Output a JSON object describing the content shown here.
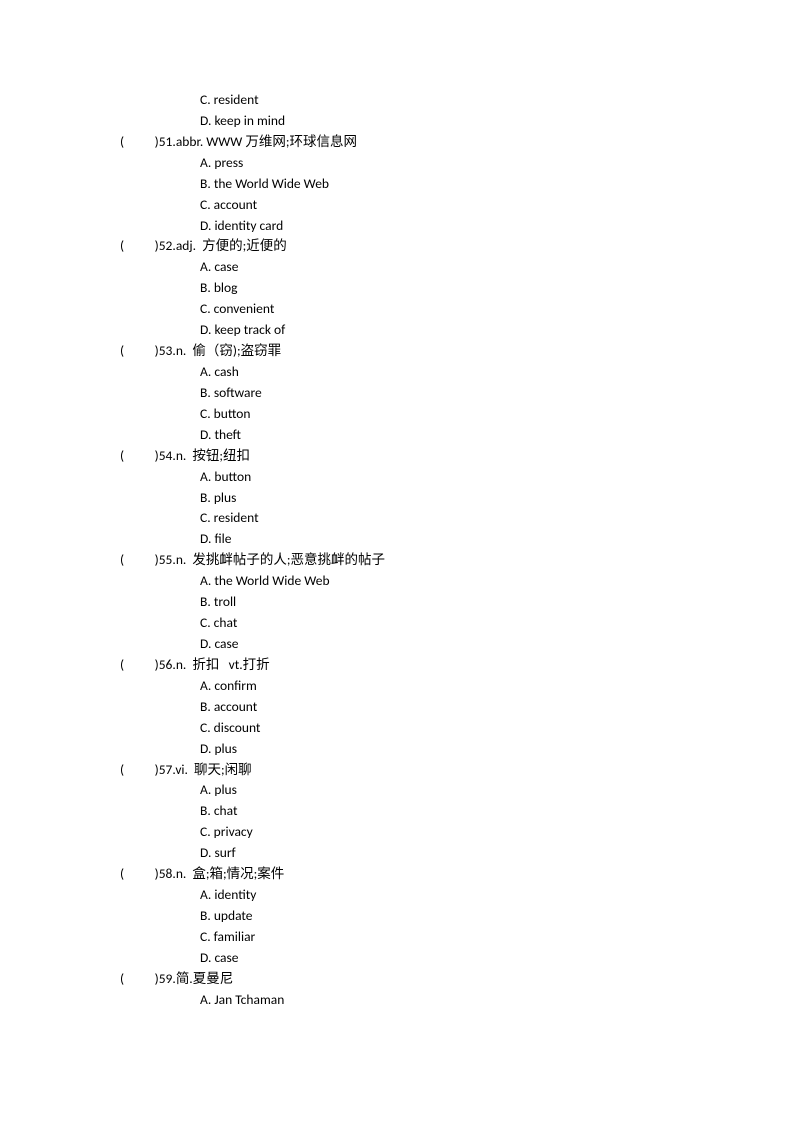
{
  "leading_options": [
    {
      "letter": "C",
      "text": "resident"
    },
    {
      "letter": "D",
      "text": "keep in mind"
    }
  ],
  "questions": [
    {
      "num": "51",
      "prompt": "abbr. WWW 万维网;环球信息网",
      "options": [
        {
          "letter": "A",
          "text": "press"
        },
        {
          "letter": "B",
          "text": "the World Wide Web"
        },
        {
          "letter": "C",
          "text": "account"
        },
        {
          "letter": "D",
          "text": "identity card"
        }
      ]
    },
    {
      "num": "52",
      "prompt": "adj.  方便的;近便的",
      "options": [
        {
          "letter": "A",
          "text": "case"
        },
        {
          "letter": "B",
          "text": "blog"
        },
        {
          "letter": "C",
          "text": "convenient"
        },
        {
          "letter": "D",
          "text": "keep track of"
        }
      ]
    },
    {
      "num": "53",
      "prompt": "n.  偷（窃);盗窃罪",
      "options": [
        {
          "letter": "A",
          "text": "cash"
        },
        {
          "letter": "B",
          "text": "software"
        },
        {
          "letter": "C",
          "text": "button"
        },
        {
          "letter": "D",
          "text": "theft"
        }
      ]
    },
    {
      "num": "54",
      "prompt": "n.  按钮;纽扣",
      "options": [
        {
          "letter": "A",
          "text": "button"
        },
        {
          "letter": "B",
          "text": "plus"
        },
        {
          "letter": "C",
          "text": "resident"
        },
        {
          "letter": "D",
          "text": "file"
        }
      ]
    },
    {
      "num": "55",
      "prompt": "n.  发挑衅帖子的人;恶意挑衅的帖子",
      "options": [
        {
          "letter": "A",
          "text": "the World Wide Web"
        },
        {
          "letter": "B",
          "text": "troll"
        },
        {
          "letter": "C",
          "text": "chat"
        },
        {
          "letter": "D",
          "text": "case"
        }
      ]
    },
    {
      "num": "56",
      "prompt": "n.  折扣   vt.打折",
      "options": [
        {
          "letter": "A",
          "text": "confirm"
        },
        {
          "letter": "B",
          "text": "account"
        },
        {
          "letter": "C",
          "text": "discount"
        },
        {
          "letter": "D",
          "text": "plus"
        }
      ]
    },
    {
      "num": "57",
      "prompt": "vi.  聊天;闲聊",
      "options": [
        {
          "letter": "A",
          "text": "plus"
        },
        {
          "letter": "B",
          "text": "chat"
        },
        {
          "letter": "C",
          "text": "privacy"
        },
        {
          "letter": "D",
          "text": "surf"
        }
      ]
    },
    {
      "num": "58",
      "prompt": "n.  盒;箱;情况;案件",
      "options": [
        {
          "letter": "A",
          "text": "identity"
        },
        {
          "letter": "B",
          "text": "update"
        },
        {
          "letter": "C",
          "text": "familiar"
        },
        {
          "letter": "D",
          "text": "case"
        }
      ]
    },
    {
      "num": "59",
      "prompt": "简.夏曼尼",
      "options": [
        {
          "letter": "A",
          "text": "Jan Tchaman"
        }
      ]
    }
  ],
  "paren_open": "(",
  "paren_close": ")",
  "dot": ". ",
  "numdot": "."
}
